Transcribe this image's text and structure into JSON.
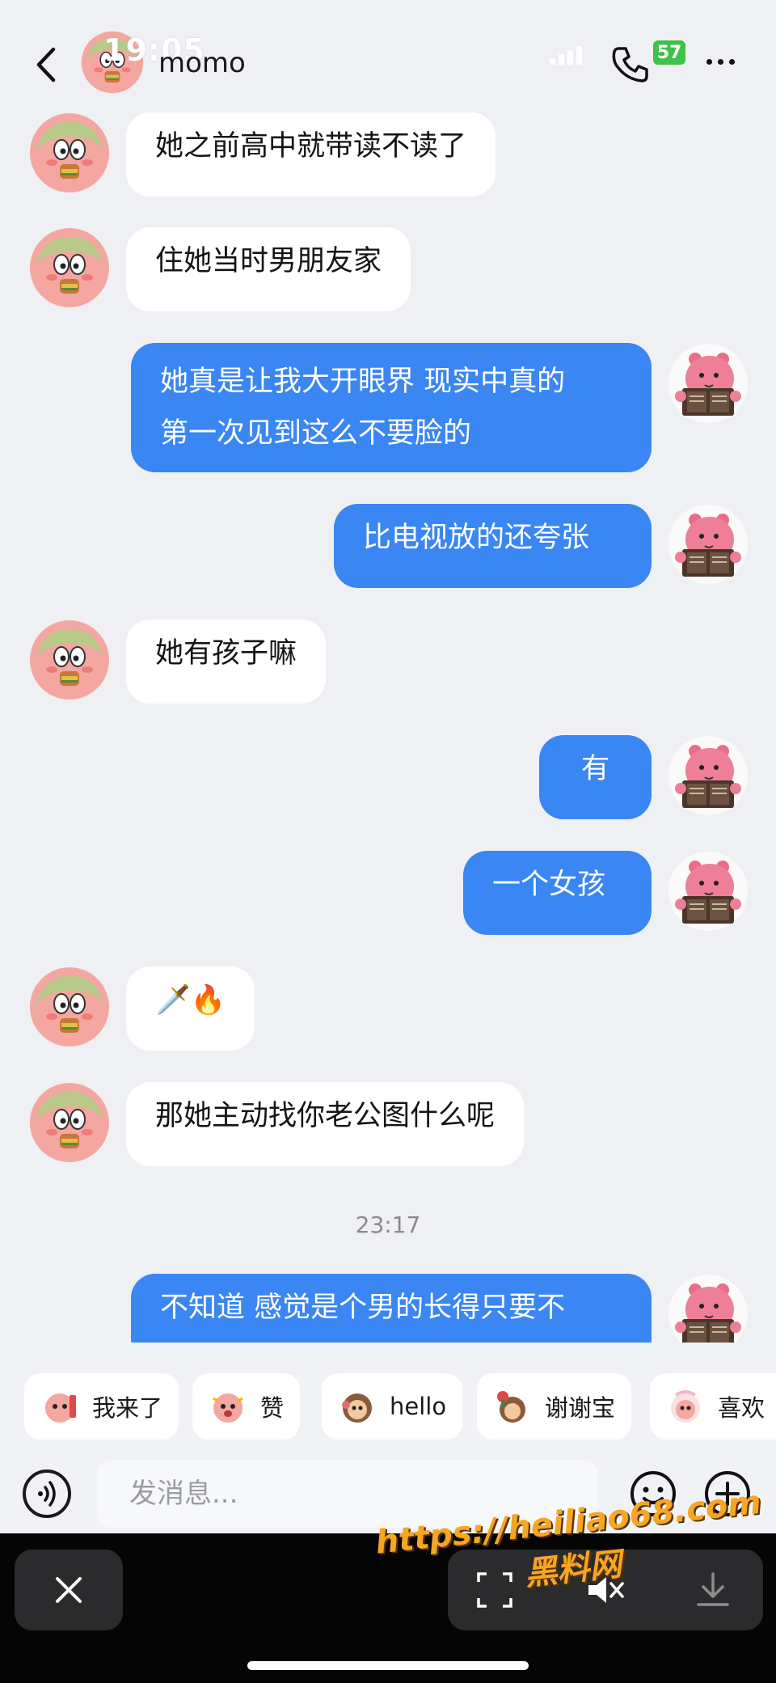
{
  "status_bar": {
    "time": "19:05",
    "battery": "57"
  },
  "header": {
    "contact_name": "momo"
  },
  "messages": [
    {
      "direction": "in",
      "text": "她之前高中就带读不读了"
    },
    {
      "direction": "in",
      "text": "住她当时男朋友家"
    },
    {
      "direction": "out",
      "lines": [
        "她真是让我大开眼界 现实中真的",
        "第一次见到这么不要脸的"
      ]
    },
    {
      "direction": "out",
      "text": "比电视放的还夸张"
    },
    {
      "direction": "in",
      "text": "她有孩子嘛"
    },
    {
      "direction": "out",
      "text": "有"
    },
    {
      "direction": "out",
      "text": "一个女孩"
    },
    {
      "direction": "in",
      "text": "🗡️🔥"
    },
    {
      "direction": "in",
      "text": "那她主动找你老公图什么呢"
    },
    {
      "direction": "out",
      "text": "不知道 感觉是个男的长得只要不"
    }
  ],
  "timestamp": "23:17",
  "quick_stickers": [
    {
      "label": "我来了"
    },
    {
      "label": "赞"
    },
    {
      "label": "hello"
    },
    {
      "label": "谢谢宝"
    },
    {
      "label": "喜欢"
    }
  ],
  "input": {
    "placeholder": "发消息..."
  },
  "watermark": {
    "url": "https://heiliao68.com",
    "name": "黑料网"
  },
  "colors": {
    "outgoing_bubble": "#3a86f2",
    "incoming_bubble": "#ffffff",
    "background": "#eff0f4"
  },
  "icons": {
    "back": "chevron-left-icon",
    "phone": "phone-icon",
    "more": "more-dots-icon",
    "voice": "voice-icon",
    "emoji": "smiley-icon",
    "plus": "plus-icon",
    "close": "close-icon",
    "mute": "mute-icon",
    "download": "download-icon"
  }
}
